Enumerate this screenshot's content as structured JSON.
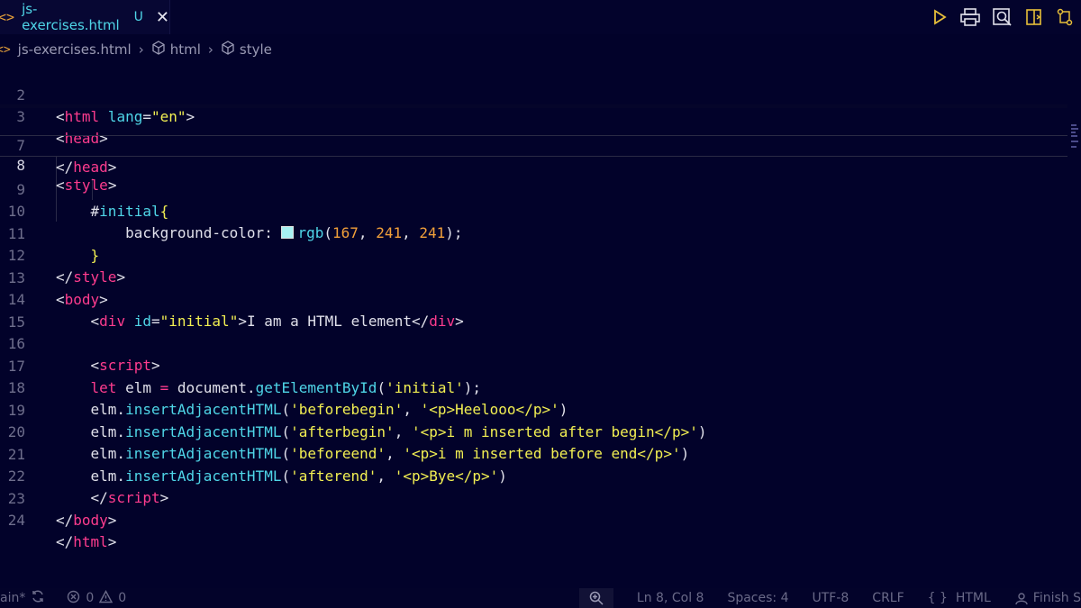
{
  "tab": {
    "chevron": "<>",
    "file_name": "js-exercises.html",
    "modified_marker": "U",
    "close_glyph": "✕"
  },
  "breadcrumb": {
    "icon": "<>",
    "file": "js-exercises.html",
    "item1": "html",
    "item2": "style"
  },
  "editor": {
    "active_line": 8,
    "swatch_color": "#a7f1f1",
    "lines": [
      {
        "n": "2"
      },
      {
        "n": "3"
      },
      {
        "n": "7"
      },
      {
        "n": "8"
      },
      {
        "n": "9"
      },
      {
        "n": "10"
      },
      {
        "n": "11"
      },
      {
        "n": "12"
      },
      {
        "n": "13"
      },
      {
        "n": "14"
      },
      {
        "n": "15"
      },
      {
        "n": "16"
      },
      {
        "n": "17"
      },
      {
        "n": "18"
      },
      {
        "n": "19"
      },
      {
        "n": "20"
      },
      {
        "n": "21"
      },
      {
        "n": "22"
      },
      {
        "n": "23"
      },
      {
        "n": "24"
      }
    ],
    "tokens": {
      "html": "html",
      "lang": "lang",
      "en": "\"en\"",
      "head": "head",
      "style": "style",
      "selector": "#initial",
      "prop": "background-color:",
      "rgb": "rgb",
      "n167": "167",
      "n241a": "241",
      "n241b": "241",
      "body": "body",
      "div": "div",
      "id": "id",
      "initial_str": "\"initial\"",
      "div_text": "I am a HTML element",
      "script": "script",
      "let": "let",
      "elm_decl": " elm ",
      "eq": "=",
      "document": " document.",
      "getById": "getElementById",
      "initial_q": "'initial'",
      "elm": "elm.",
      "insert": "insertAdjacentHTML",
      "s18a": "'beforebegin'",
      "s18b": "'<p>Heelooo</p>'",
      "s19a": "'afterbegin'",
      "s19b": "'<p>i m inserted after begin</p>'",
      "s20a": "'beforeend'",
      "s20b": "'<p>i m inserted before end</p>'",
      "s21a": "'afterend'",
      "s21b": "'<p>Bye</p>'"
    }
  },
  "statusbar": {
    "branch": "ain*",
    "errors": "0",
    "warnings": "0",
    "position": "Ln 8, Col 8",
    "spaces": "Spaces: 4",
    "encoding": "UTF-8",
    "eol": "CRLF",
    "language_braces": "{ }",
    "language": "HTML",
    "finish": "Finish S"
  }
}
